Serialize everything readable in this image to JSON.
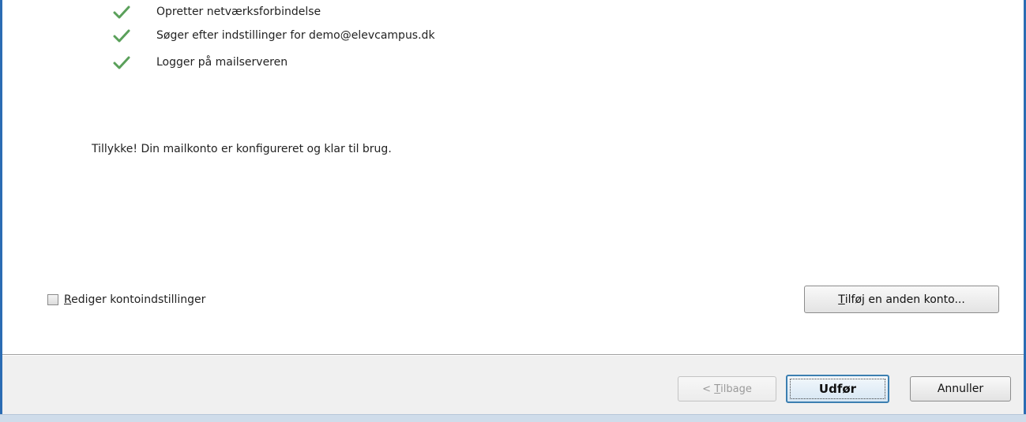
{
  "steps": [
    {
      "label": "Opretter netværksforbindelse",
      "icon": "check-icon"
    },
    {
      "label": "Søger efter indstillinger for demo@elevcampus.dk",
      "icon": "check-icon"
    },
    {
      "label": "Logger på mailserveren",
      "icon": "check-icon"
    }
  ],
  "message": "Tillykke! Din mailkonto er konfigureret og klar til brug.",
  "edit_settings": {
    "accel": "R",
    "label_rest": "ediger kontoindstillinger",
    "checked": false
  },
  "add_account": {
    "accel": "T",
    "label_rest": "ilføj en anden konto..."
  },
  "back": {
    "prefix": "< ",
    "accel": "T",
    "label_rest": "ilbage",
    "enabled": false
  },
  "finish_label": "Udfør",
  "cancel_label": "Annuller",
  "colors": {
    "accent_border": "#2b6cb3",
    "check_green": "#5aa05a",
    "default_button_border": "#3c7fb1"
  }
}
